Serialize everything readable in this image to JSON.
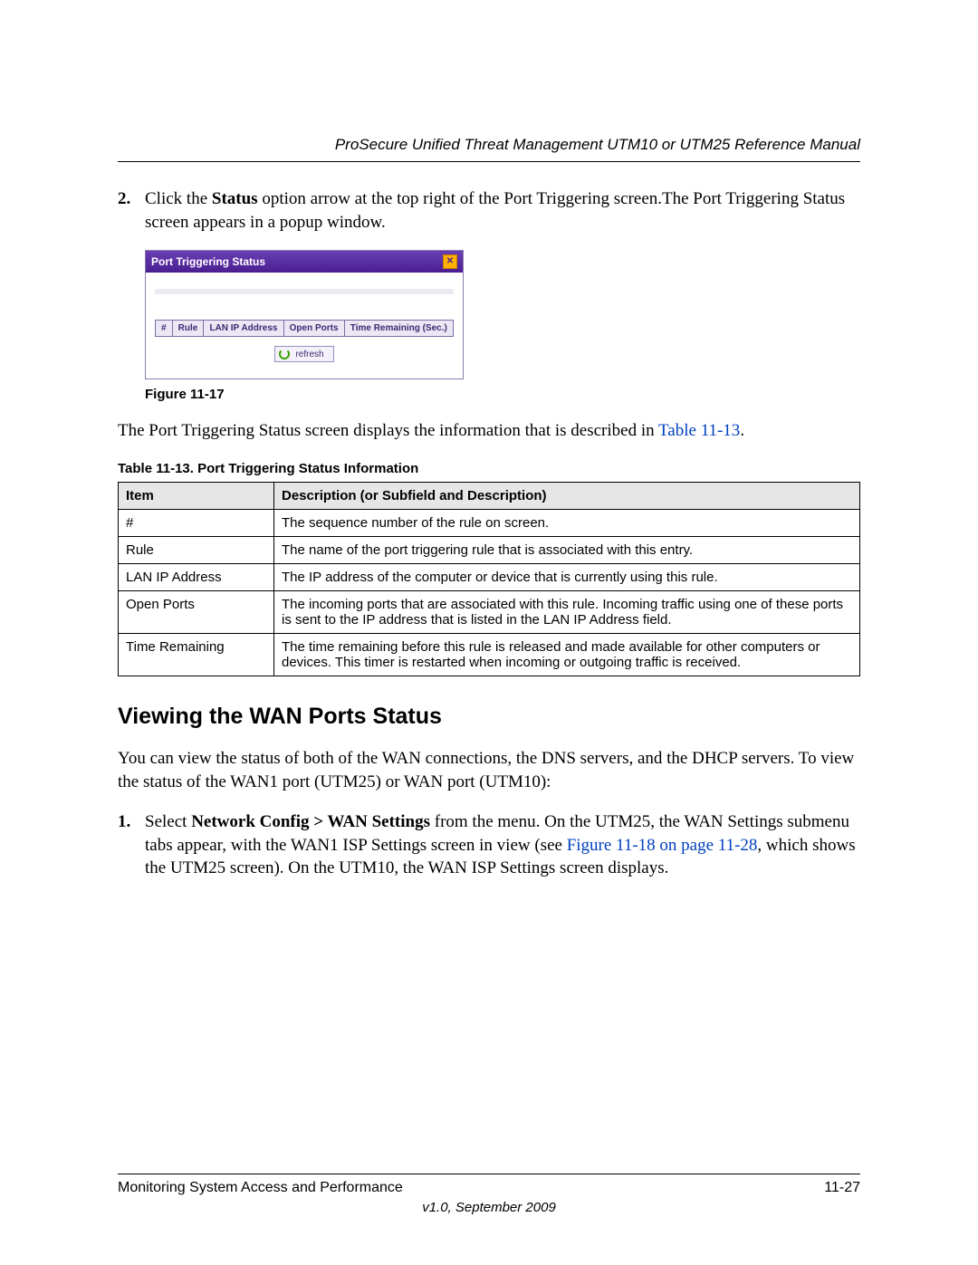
{
  "header": {
    "running_title": "ProSecure Unified Threat Management UTM10 or UTM25 Reference Manual"
  },
  "step2": {
    "number": "2.",
    "prefix": "Click the ",
    "bold": "Status",
    "suffix": " option arrow at the top right of the Port Triggering screen.The Port Triggering Status screen appears in a popup window."
  },
  "popup": {
    "title": "Port Triggering Status",
    "close_symbol": "✕",
    "columns": [
      "#",
      "Rule",
      "LAN IP Address",
      "Open Ports",
      "Time Remaining (Sec.)"
    ],
    "refresh_label": "refresh"
  },
  "figure_caption": "Figure 11-17",
  "para_after_fig": {
    "text": "The Port Triggering Status screen displays the information that is described in ",
    "link": "Table 11-13",
    "suffix": "."
  },
  "table_caption": "Table 11-13. Port Triggering Status Information",
  "info_table": {
    "headers": [
      "Item",
      "Description (or Subfield and Description)"
    ],
    "rows": [
      {
        "item": "#",
        "desc": "The sequence number of the rule on screen."
      },
      {
        "item": "Rule",
        "desc": "The name of the port triggering rule that is associated with this entry."
      },
      {
        "item": "LAN IP Address",
        "desc": "The IP address of the computer or device that is currently using this rule."
      },
      {
        "item": "Open Ports",
        "desc": "The incoming ports that are associated with this rule. Incoming traffic using one of these ports is sent to the IP address that is listed in the LAN IP Address field."
      },
      {
        "item": "Time Remaining",
        "desc": "The time remaining before this rule is released and made available for other computers or devices. This timer is restarted when incoming or outgoing traffic is received."
      }
    ]
  },
  "section_heading": "Viewing the WAN Ports Status",
  "section_intro": "You can view the status of both of the WAN connections, the DNS servers, and the DHCP servers. To view the status of the WAN1 port (UTM25) or WAN port (UTM10):",
  "step1": {
    "number": "1.",
    "part1": "Select ",
    "bold": "Network Config > WAN Settings",
    "part2": " from the menu. On the UTM25, the WAN Settings submenu tabs appear, with the WAN1 ISP Settings screen in view (see ",
    "link": "Figure 11-18 on page 11-28",
    "part3": ", which shows the UTM25 screen). On the UTM10, the WAN ISP Settings screen displays."
  },
  "footer": {
    "left": "Monitoring System Access and Performance",
    "right": "11-27",
    "version": "v1.0, September 2009"
  }
}
